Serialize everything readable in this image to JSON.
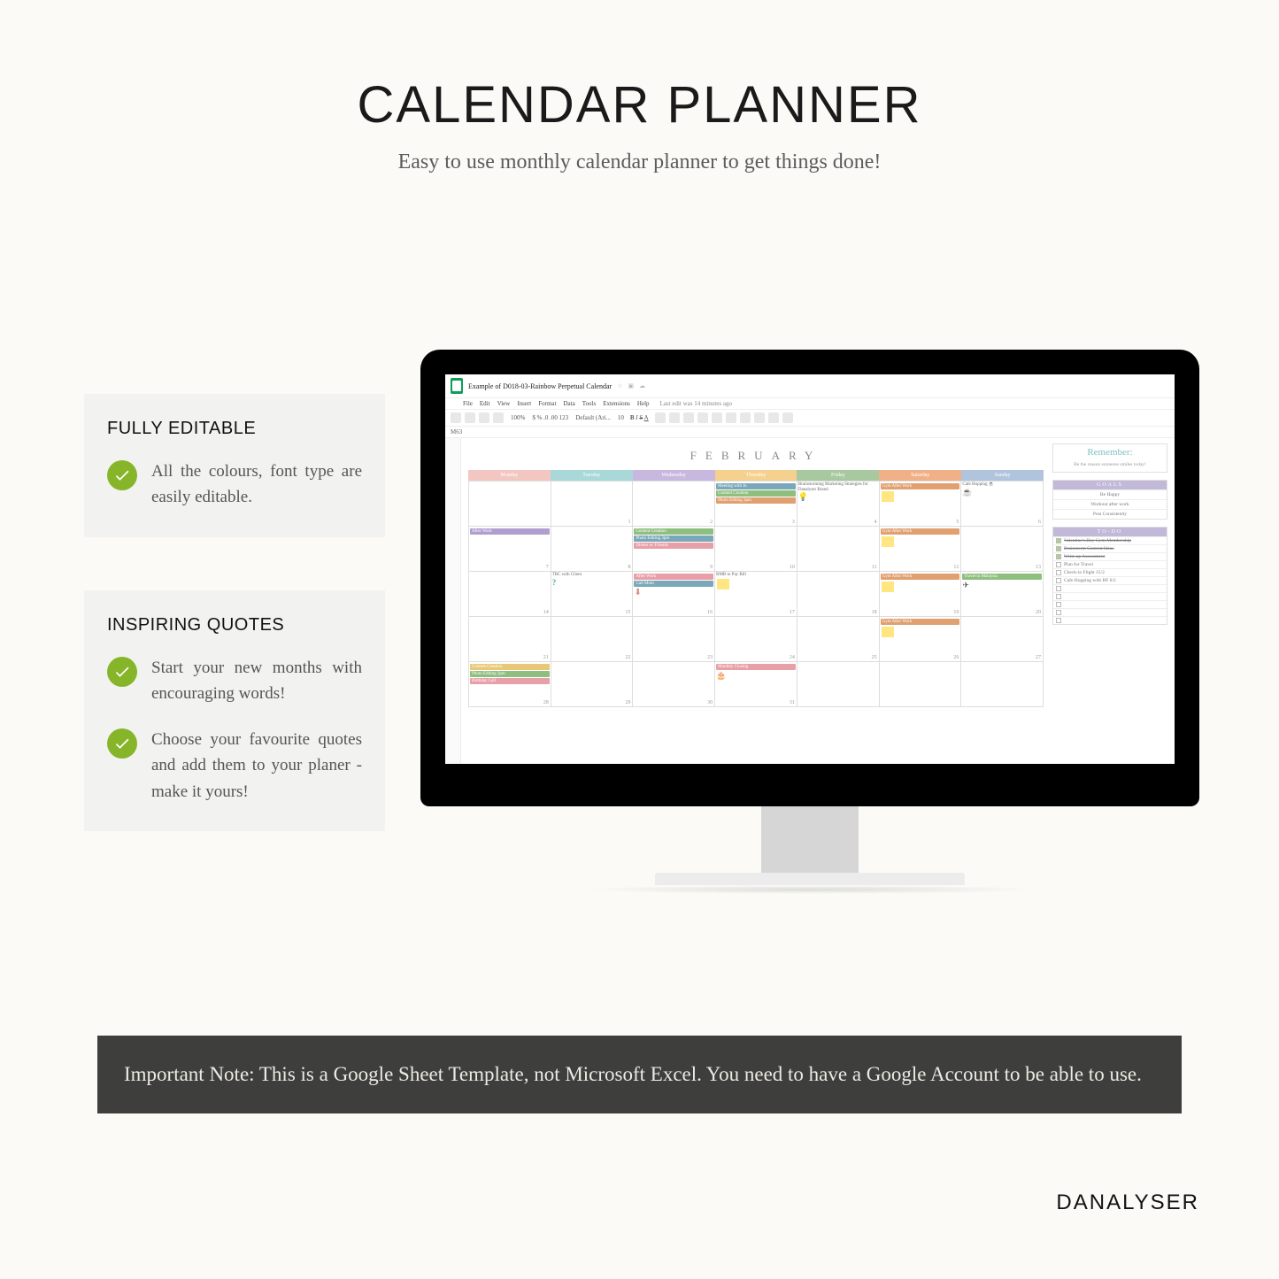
{
  "header": {
    "title": "CALENDAR PLANNER",
    "subtitle": "Easy to use monthly calendar planner to get things done!"
  },
  "features": {
    "card1": {
      "heading": "FULLY EDITABLE",
      "bullets": [
        "All the colours, font type are easily editable."
      ]
    },
    "card2": {
      "heading": "INSPIRING QUOTES",
      "bullets": [
        "Start your new months with encouraging words!",
        "Choose your favourite quotes and add them to your planer - make it yours!"
      ]
    }
  },
  "doc": {
    "title": "Example of D018-03-Rainbow Perpetual Calendar",
    "status": "Last edit was 14 minutes ago",
    "menu": [
      "File",
      "Edit",
      "View",
      "Insert",
      "Format",
      "Data",
      "Tools",
      "Extensions",
      "Help"
    ],
    "cellref": "M63"
  },
  "calendar": {
    "month": "FEBRUARY",
    "dow": [
      "Monday",
      "Tuesday",
      "Wednesday",
      "Thursday",
      "Friday",
      "Saturday",
      "Sunday"
    ],
    "weeks": [
      [
        {
          "n": "",
          "ev": []
        },
        {
          "n": "1",
          "ev": []
        },
        {
          "n": "2",
          "ev": []
        },
        {
          "n": "3",
          "ev": [
            {
              "c": "bl",
              "t": "Meeting with Jo"
            },
            {
              "c": "gr",
              "t": "Content Creation"
            },
            {
              "c": "or",
              "t": "Photo Editing 3pm"
            }
          ]
        },
        {
          "n": "4",
          "ev": [
            {
              "c": "",
              "t": "Brainstorming Marketing Strategies for Danalyser Brand"
            }
          ],
          "icon": "bulb"
        },
        {
          "n": "5",
          "ev": [
            {
              "c": "or",
              "t": "Gym After Work"
            }
          ],
          "icon": "sticky"
        },
        {
          "n": "6",
          "ev": [
            {
              "c": "",
              "t": "Cafe Hopping ☕"
            }
          ],
          "icon": "cup"
        }
      ],
      [
        {
          "n": "7",
          "ev": [
            {
              "c": "pu",
              "t": "After Work"
            }
          ]
        },
        {
          "n": "8",
          "ev": []
        },
        {
          "n": "9",
          "ev": [
            {
              "c": "gr",
              "t": "Content Creation"
            },
            {
              "c": "bl",
              "t": "Photo Editing 3pm"
            },
            {
              "c": "pk",
              "t": "Dinner w/ Friends"
            }
          ]
        },
        {
          "n": "10",
          "ev": []
        },
        {
          "n": "11",
          "ev": []
        },
        {
          "n": "12",
          "ev": [
            {
              "c": "or",
              "t": "Gym After Work"
            }
          ],
          "icon": "sticky"
        },
        {
          "n": "13",
          "ev": []
        }
      ],
      [
        {
          "n": "14",
          "ev": []
        },
        {
          "n": "15",
          "ev": [
            {
              "c": "",
              "t": "TBC with Client"
            }
          ],
          "icon": "qmark"
        },
        {
          "n": "16",
          "ev": [
            {
              "c": "pk",
              "t": "After Work"
            },
            {
              "c": "bl",
              "t": "Call Mom"
            }
          ],
          "icon": "arrow"
        },
        {
          "n": "17",
          "ev": [
            {
              "c": "",
              "t": "RMB to Pay Bill"
            }
          ],
          "icon": "sticky"
        },
        {
          "n": "18",
          "ev": []
        },
        {
          "n": "19",
          "ev": [
            {
              "c": "or",
              "t": "Gym After Work"
            }
          ],
          "icon": "sticky"
        },
        {
          "n": "20",
          "ev": [
            {
              "c": "gr",
              "t": "Travel to Malaysia"
            }
          ],
          "icon": "plane"
        }
      ],
      [
        {
          "n": "21",
          "ev": []
        },
        {
          "n": "22",
          "ev": []
        },
        {
          "n": "23",
          "ev": []
        },
        {
          "n": "24",
          "ev": []
        },
        {
          "n": "25",
          "ev": []
        },
        {
          "n": "26",
          "ev": [
            {
              "c": "or",
              "t": "Gym After Work"
            }
          ],
          "icon": "sticky"
        },
        {
          "n": "27",
          "ev": []
        }
      ],
      [
        {
          "n": "28",
          "ev": [
            {
              "c": "ye",
              "t": "Content Creation"
            },
            {
              "c": "gr",
              "t": "Photo Editing 3pm"
            },
            {
              "c": "pk",
              "t": "Birthday Call"
            }
          ]
        },
        {
          "n": "29",
          "ev": []
        },
        {
          "n": "30",
          "ev": []
        },
        {
          "n": "31",
          "ev": [
            {
              "c": "pk",
              "t": "Monthly Closing"
            }
          ],
          "icon": "cake"
        },
        {
          "n": "",
          "ev": []
        },
        {
          "n": "",
          "ev": []
        },
        {
          "n": "",
          "ev": []
        }
      ]
    ]
  },
  "sidebar": {
    "remember_label": "Remember:",
    "quote": "Be the reason someone smiles today!",
    "goals_title": "GOALS",
    "goals": [
      "Be Happy",
      "Workout after work",
      "Post Consistently"
    ],
    "todo_title": "TO-DO",
    "todos": [
      {
        "t": "Valentine's Day Gym Membership",
        "done": true
      },
      {
        "t": "Brainstorm Content Ideas",
        "done": true
      },
      {
        "t": "Write up Assessment",
        "done": true
      },
      {
        "t": "Plan for Travel",
        "done": false
      },
      {
        "t": "Check-in Flight 15/2",
        "done": false
      },
      {
        "t": "Cafe Hopping with BF 6/2",
        "done": false
      },
      {
        "t": "",
        "done": false
      },
      {
        "t": "",
        "done": false
      },
      {
        "t": "",
        "done": false
      },
      {
        "t": "",
        "done": false
      },
      {
        "t": "",
        "done": false
      }
    ]
  },
  "note": {
    "text": "Important Note: This is a Google Sheet Template, not Microsoft Excel. You need to have a Google Account to be able to use."
  },
  "brand": "DANALYSER"
}
